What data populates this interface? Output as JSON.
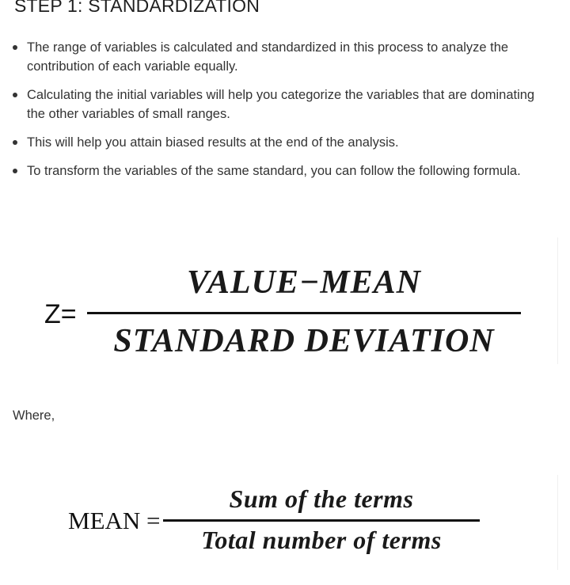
{
  "heading": "STEP 1: STANDARDIZATION",
  "bullets": [
    "The range of variables is calculated and standardized in this process to analyze the contribution of each variable equally.",
    "Calculating the initial variables will help you categorize the variables that are dominating the other variables of small ranges.",
    "This will help you attain biased results at the end of the analysis.",
    "To transform the variables of the same standard, you can follow the following formula."
  ],
  "z_formula": {
    "lhs": "Z=",
    "numerator": "VALUE−MEAN",
    "denominator": "STANDARD DEVIATION"
  },
  "where_text": "Where,",
  "mean_formula": {
    "lhs": "MEAN =",
    "numerator": "Sum of the terms",
    "denominator": "Total number of terms"
  }
}
